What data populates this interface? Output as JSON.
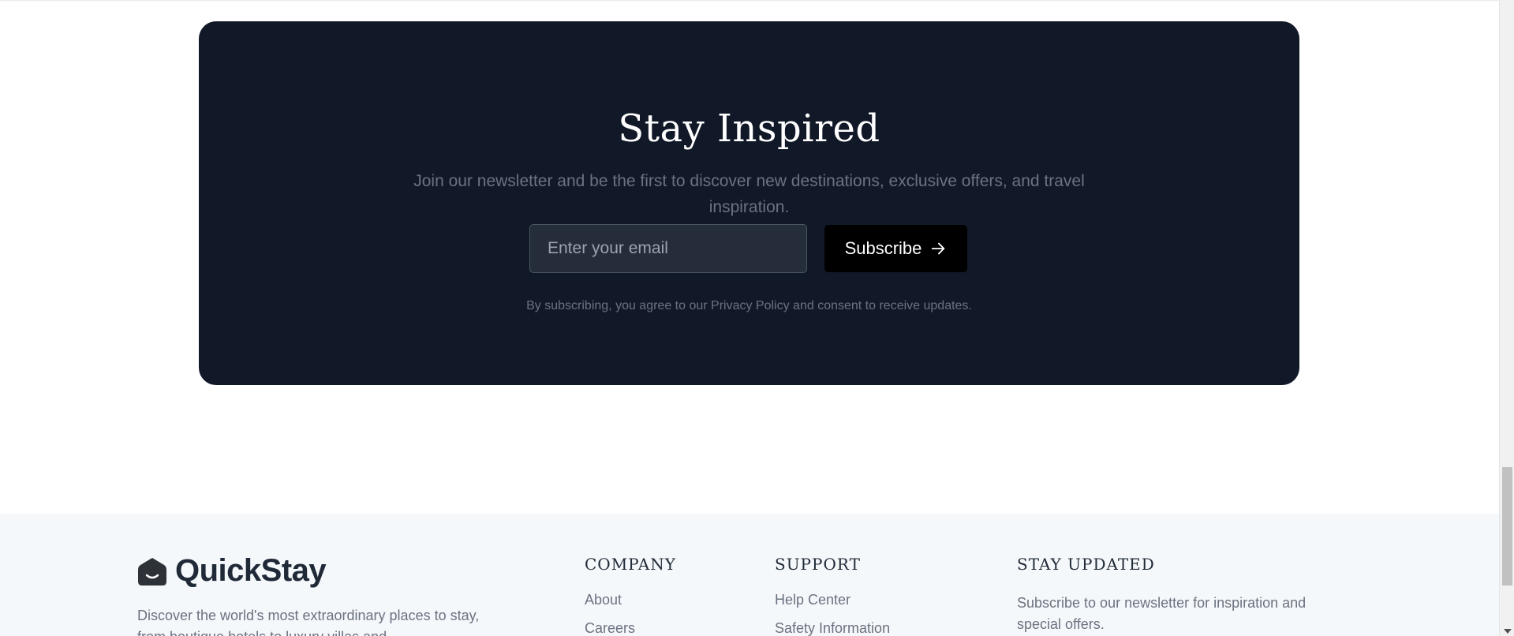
{
  "newsletter": {
    "title": "Stay Inspired",
    "subtitle": "Join our newsletter and be the first to discover new destinations, exclusive offers, and travel inspiration.",
    "email_placeholder": "Enter your email",
    "subscribe_label": "Subscribe",
    "subscribe_icon": "arrow-right-icon",
    "note": "By subscribing, you agree to our Privacy Policy and consent to receive updates."
  },
  "footer": {
    "brand": {
      "name": "QuickStay",
      "logo_icon": "house-smile-icon",
      "description": "Discover the world's most extraordinary places to stay, from boutique hotels to luxury villas and"
    },
    "columns": [
      {
        "heading": "COMPANY",
        "links": [
          "About",
          "Careers"
        ]
      },
      {
        "heading": "SUPPORT",
        "links": [
          "Help Center",
          "Safety Information"
        ]
      }
    ],
    "updates": {
      "heading": "STAY UPDATED",
      "text": "Subscribe to our newsletter for inspiration and special offers."
    }
  },
  "colors": {
    "card_bg": "#111827",
    "footer_bg": "#f5f8fa",
    "button_bg": "#000000",
    "muted_text": "#6b7280"
  }
}
